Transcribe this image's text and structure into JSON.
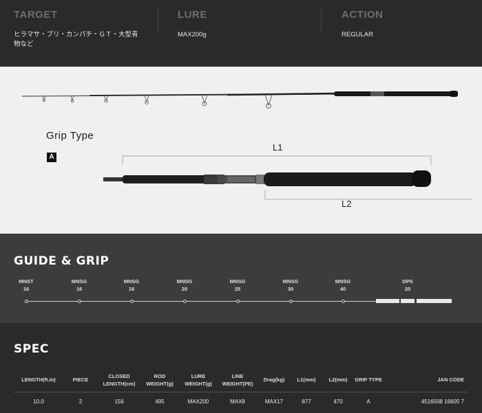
{
  "summary": {
    "target": {
      "label": "TARGET",
      "value": "ヒラマサ・ブリ・カンパチ・ＧＴ・大型青物など"
    },
    "lure": {
      "label": "LURE",
      "value": "MAX200g"
    },
    "action": {
      "label": "ACTION",
      "value": "REGULAR"
    }
  },
  "rod": {
    "grip_type_title": "Grip Type",
    "grip_type_badge": "A",
    "dim_l1": "L1",
    "dim_l2": "L2"
  },
  "guide_grip": {
    "title": "GUIDE & GRIP",
    "items": [
      {
        "type": "MNST",
        "size": "16"
      },
      {
        "type": "MNSG",
        "size": "16"
      },
      {
        "type": "MNSG",
        "size": "16"
      },
      {
        "type": "MNSG",
        "size": "20"
      },
      {
        "type": "MNSG",
        "size": "25"
      },
      {
        "type": "MNSG",
        "size": "30"
      },
      {
        "type": "MNSG",
        "size": "40"
      },
      {
        "type": "DPS",
        "size": "20"
      }
    ]
  },
  "spec": {
    "title": "SPEC",
    "headers": [
      "LENGTH(ft.in)",
      "PIECE",
      "CLOSED LENGTH(cm)",
      "ROD WEIGHT(g)",
      "LURE WEIGHT(g)",
      "LINE WEIGHT(PE)",
      "Drag(kg)",
      "L1(mm)",
      "L2(mm)",
      "GRIP TYPE",
      "JAN CODE"
    ],
    "rows": [
      [
        "10.0",
        "2",
        "156",
        "495",
        "MAX200",
        "MAX8",
        "MAX17",
        "877",
        "470",
        "A",
        "4516508 16605 7"
      ]
    ]
  },
  "colors": {
    "dark_bg": "#2a2a2a",
    "guide_bg": "#3c3c3c",
    "light_bg": "#f0f0f0",
    "muted_label": "#6e6e6e"
  }
}
